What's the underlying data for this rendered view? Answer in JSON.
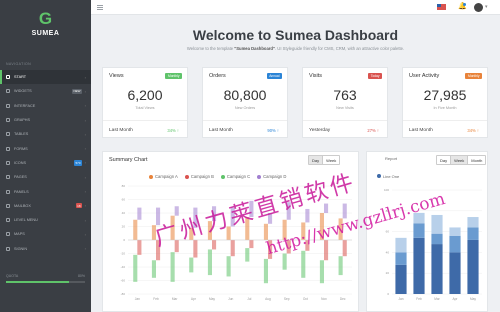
{
  "sidebar": {
    "logo_mark": "G",
    "brand": "SUMEA",
    "nav_heading": "NAVIGATION",
    "items": [
      {
        "label": "START",
        "active": true,
        "icon": "home-icon"
      },
      {
        "label": "WIDGETS",
        "badge": "NEW",
        "badge_color": "#5a6068",
        "icon": "widget-icon"
      },
      {
        "label": "INTERFACE",
        "icon": "layout-icon"
      },
      {
        "label": "GRAPHS",
        "icon": "chart-icon"
      },
      {
        "label": "TABLES",
        "icon": "table-icon"
      },
      {
        "label": "FORMS",
        "icon": "form-icon"
      },
      {
        "label": "ICONS",
        "badge": "570",
        "badge_color": "#2b84d6",
        "icon": "star-icon"
      },
      {
        "label": "PAGES",
        "icon": "file-icon"
      },
      {
        "label": "PANELS",
        "icon": "panel-icon"
      },
      {
        "label": "MAILBOX",
        "badge": "18",
        "badge_color": "#d9534f",
        "icon": "mail-icon"
      },
      {
        "label": "LEVEL MENU",
        "icon": "list-icon"
      },
      {
        "label": "MAPS",
        "icon": "map-icon"
      },
      {
        "label": "SIGNIN",
        "icon": "user-icon"
      }
    ],
    "quota_label": "QUOTA",
    "quota_value": "80%",
    "quota_fraction": 0.8
  },
  "page": {
    "title": "Welcome to Sumea Dashboard",
    "subtitle_pre": "Welcome to the template ",
    "subtitle_bold": "\"Sumea Dashboard\"",
    "subtitle_post": ". UI Styleguide friendly for CMS, CRM, with an attractive color palette."
  },
  "cards": [
    {
      "title": "Views",
      "badge": "Monthly",
      "badge_color": "#5fc36a",
      "value": "6,200",
      "label": "Total Views",
      "foot_left": "Last Month",
      "foot_right": "34% ↑",
      "foot_color": "#5fc36a"
    },
    {
      "title": "Orders",
      "badge": "Annual",
      "badge_color": "#2b84d6",
      "value": "80,800",
      "label": "New Orders",
      "foot_left": "Last Month",
      "foot_right": "90% ↑",
      "foot_color": "#2b84d6"
    },
    {
      "title": "Visits",
      "badge": "Today",
      "badge_color": "#d9534f",
      "value": "763",
      "label": "New Visits",
      "foot_left": "Yesterday",
      "foot_right": "27% ↑",
      "foot_color": "#d9534f"
    },
    {
      "title": "User Activity",
      "badge": "Monthly",
      "badge_color": "#e8833a",
      "value": "27,985",
      "label": "In Five Month",
      "foot_left": "Last Month",
      "foot_right": "34% ↑",
      "foot_color": "#e8833a"
    }
  ],
  "summary": {
    "title": "Summary Chart",
    "tabs": [
      "Day",
      "Week"
    ],
    "selected_tab": "Day"
  },
  "right_panel": {
    "title": "Report",
    "tabs": [
      "Day",
      "Week",
      "Month"
    ],
    "selected_tab": "Week",
    "legend_text": "Line One"
  },
  "watermark": {
    "line1": "广州力莱直销软件",
    "line2": "http://www.gzllrj.com"
  },
  "colors": {
    "green": "#5fc36a",
    "blue": "#2b84d6",
    "red": "#d9534f",
    "orange": "#e8833a"
  },
  "chart_data": [
    {
      "type": "bar",
      "title": "Summary Chart",
      "categories": [
        "Jan",
        "Feb",
        "Mar",
        "Apr",
        "May",
        "Jun",
        "Jul",
        "Aug",
        "Sep",
        "Oct",
        "Nov",
        "Dec"
      ],
      "ylim": [
        -80,
        80
      ],
      "series": [
        {
          "name": "Campaign A",
          "color": "#e8833a",
          "values": [
            30,
            22,
            36,
            18,
            28,
            20,
            34,
            24,
            30,
            26,
            40,
            32
          ]
        },
        {
          "name": "Campaign B",
          "color": "#d9534f",
          "values": [
            -22,
            -30,
            -18,
            -26,
            -14,
            -24,
            -12,
            -28,
            -20,
            -16,
            -30,
            -24
          ]
        },
        {
          "name": "Campaign C",
          "color": "#5fc36a",
          "values": [
            -40,
            -26,
            -44,
            -22,
            -38,
            -30,
            -20,
            -36,
            -24,
            -40,
            -34,
            -28
          ]
        },
        {
          "name": "Campaign D",
          "color": "#a17fd0",
          "values": [
            18,
            26,
            14,
            30,
            22,
            28,
            24,
            16,
            26,
            20,
            14,
            22
          ]
        }
      ]
    },
    {
      "type": "bar",
      "categories": [
        "Jan",
        "Feb",
        "Mar",
        "Apr",
        "May"
      ],
      "ylim": [
        0,
        100
      ],
      "series": [
        {
          "name": "Line One",
          "color": "#3e6aa8",
          "values": [
            28,
            54,
            48,
            40,
            52
          ]
        },
        {
          "color": "#6a9bd0",
          "values": [
            12,
            14,
            10,
            16,
            12
          ]
        },
        {
          "color": "#b8d0ea",
          "values": [
            14,
            10,
            18,
            8,
            10
          ]
        }
      ]
    }
  ]
}
